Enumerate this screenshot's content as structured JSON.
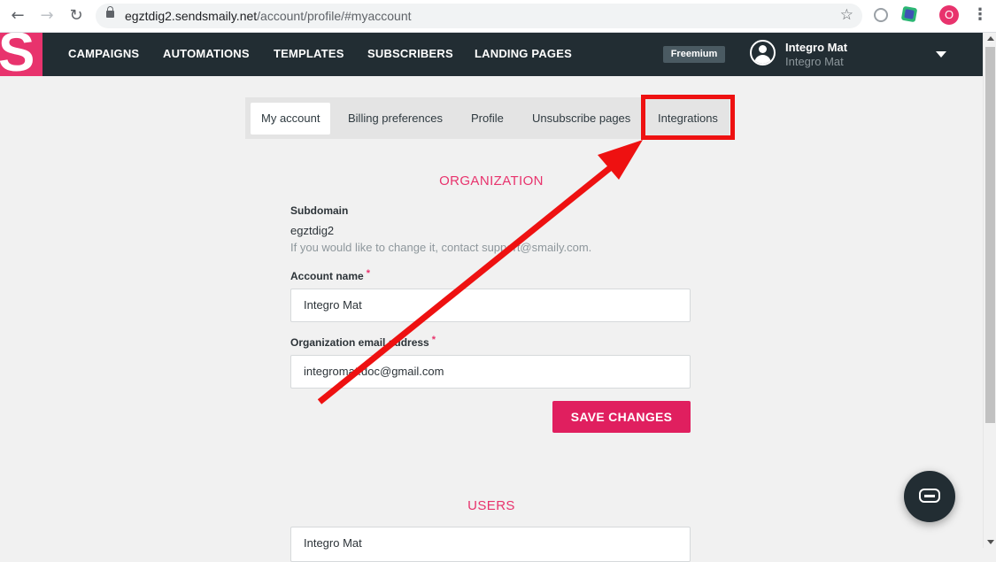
{
  "browser": {
    "url_host": "egztdig2.sendsmaily.net",
    "url_path": "/account/profile/#myaccount",
    "profile_initial": "O"
  },
  "header": {
    "logo": "S",
    "nav": [
      "CAMPAIGNS",
      "AUTOMATIONS",
      "TEMPLATES",
      "SUBSCRIBERS",
      "LANDING PAGES"
    ],
    "plan_badge": "Freemium",
    "user_name": "Integro Mat",
    "user_subtitle": "Integro Mat"
  },
  "tabs": {
    "my_account": "My account",
    "billing": "Billing preferences",
    "profile": "Profile",
    "unsubscribe": "Unsubscribe pages",
    "integrations": "Integrations",
    "active": "My account"
  },
  "organization": {
    "title": "ORGANIZATION",
    "subdomain_label": "Subdomain",
    "subdomain_value": "egztdig2",
    "subdomain_hint": "If you would like to change it, contact support@smaily.com.",
    "account_name_label": "Account name",
    "account_name_value": "Integro Mat",
    "email_label": "Organization email address",
    "email_value": "integromat.doc@gmail.com",
    "required_mark": "*",
    "save_label": "SAVE CHANGES"
  },
  "users": {
    "title": "USERS",
    "first_user": "Integro Mat"
  },
  "colors": {
    "brand": "#e8336d",
    "header_bg": "#222d33",
    "annotation": "#ee1111"
  },
  "icons": {
    "back": "arrow-left-icon",
    "forward": "arrow-right-icon",
    "reload": "reload-icon",
    "lock": "lock-icon",
    "star": "star-icon",
    "menu": "kebab-menu-icon",
    "chat": "chat-icon"
  }
}
